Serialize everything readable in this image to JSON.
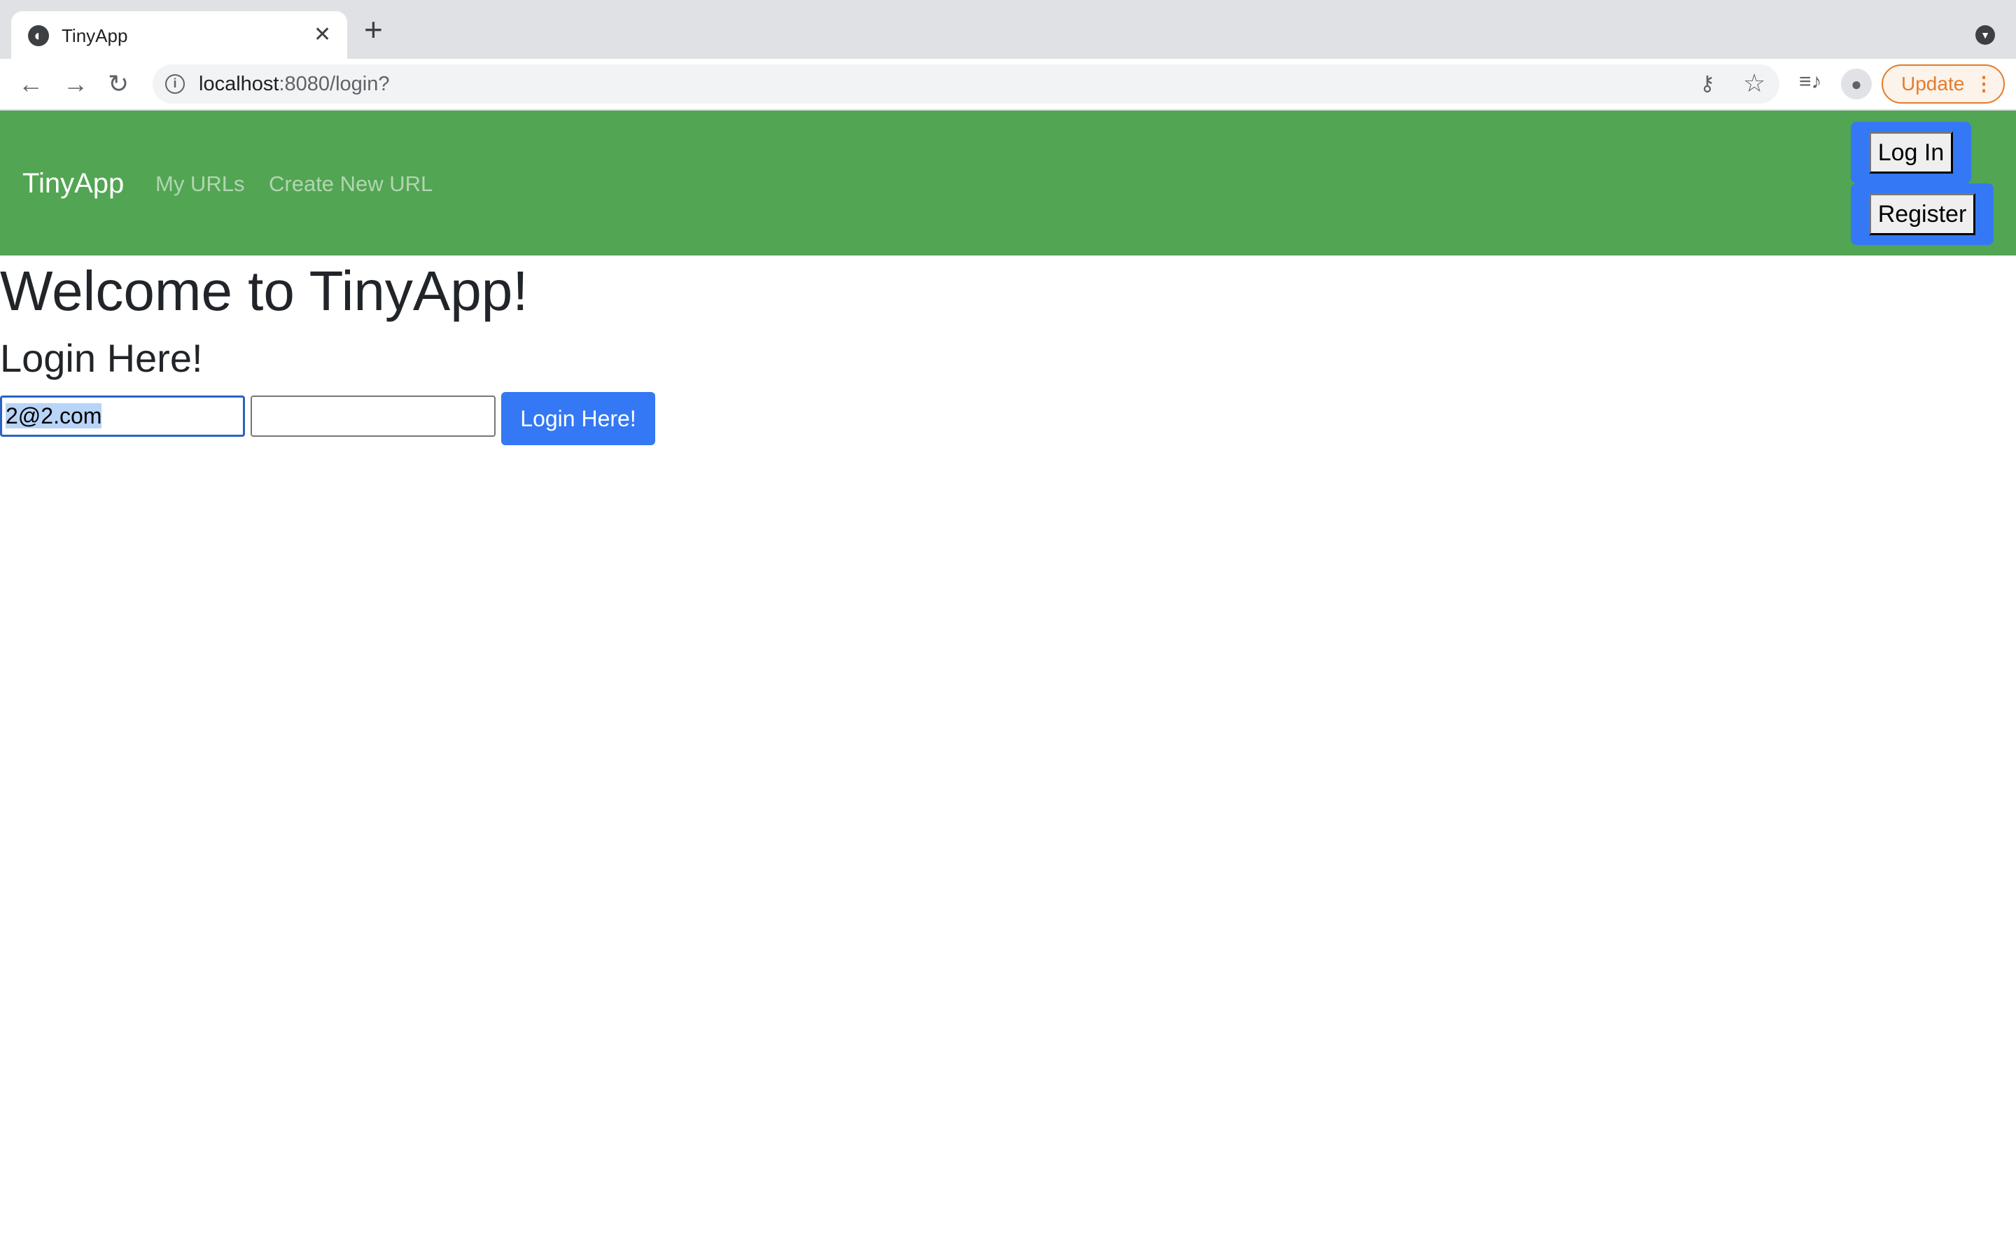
{
  "browser": {
    "tab_title": "TinyApp",
    "url_host": "localhost",
    "url_rest": ":8080/login?",
    "update_label": "Update"
  },
  "navbar": {
    "brand": "TinyApp",
    "links": [
      "My URLs",
      "Create New URL"
    ],
    "login_button": "Log In",
    "register_button": "Register"
  },
  "main": {
    "title": "Welcome to TinyApp!",
    "subtitle": "Login Here!",
    "email_value": "2@2.com",
    "password_value": "",
    "submit_label": "Login Here!"
  },
  "colors": {
    "navbar": "#52a552",
    "primary": "#3578f5",
    "update": "#e37c2c"
  }
}
